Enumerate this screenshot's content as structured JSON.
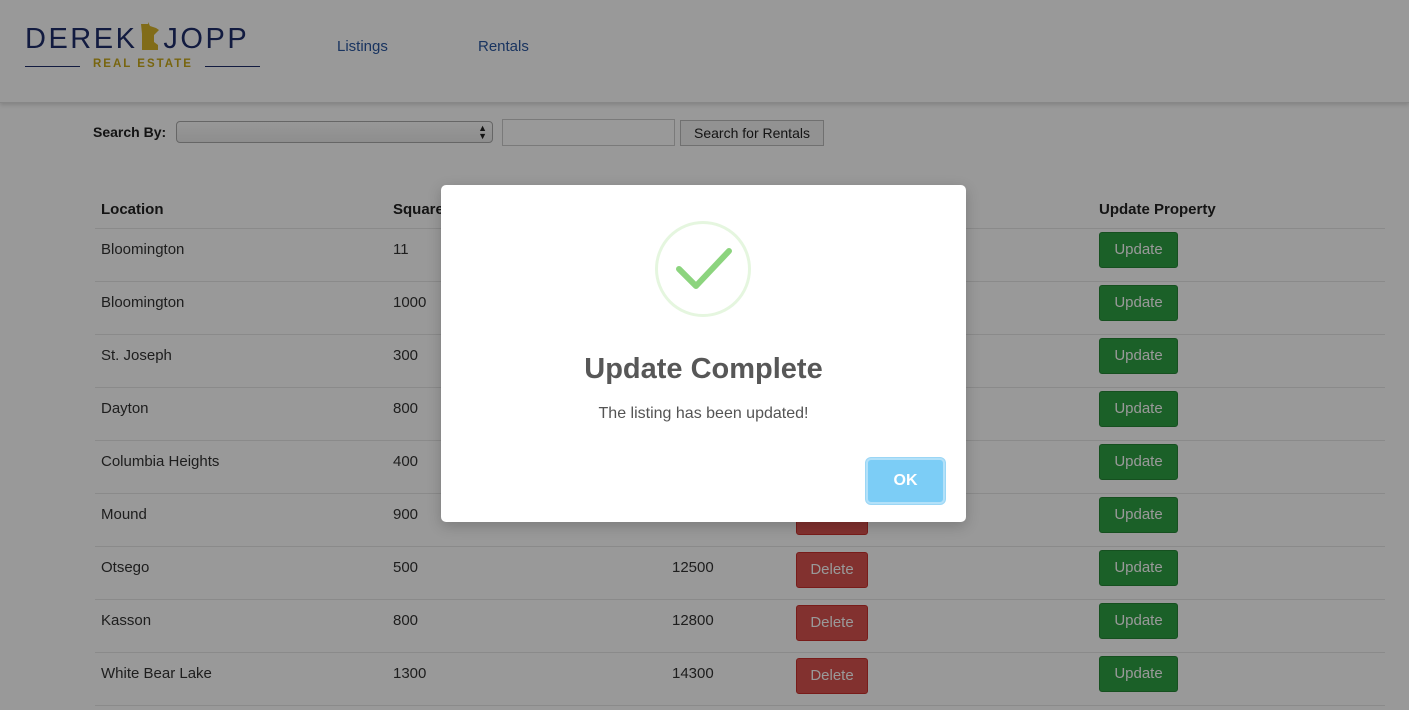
{
  "brand": {
    "name_left": "DEREK",
    "name_right": "JOPP",
    "subtitle": "REAL ESTATE",
    "text_color": "#1f2d6b",
    "accent_color": "#c9a91a"
  },
  "nav": {
    "items": [
      {
        "label": "Listings"
      },
      {
        "label": "Rentals"
      }
    ]
  },
  "search": {
    "label": "Search By:",
    "select_value": "",
    "input_value": "",
    "button_label": "Search for Rentals"
  },
  "table": {
    "headers": {
      "location": "Location",
      "square": "Square",
      "update_property": "Update Property"
    },
    "delete_label": "Delete",
    "update_label": "Update",
    "rows": [
      {
        "location": "Bloomington",
        "square": "11",
        "rent": "",
        "delete_visible": false
      },
      {
        "location": "Bloomington",
        "square": "1000",
        "rent": "",
        "delete_visible": false
      },
      {
        "location": "St. Joseph",
        "square": "300",
        "rent": "",
        "delete_visible": false
      },
      {
        "location": "Dayton",
        "square": "800",
        "rent": "",
        "delete_visible": false
      },
      {
        "location": "Columbia Heights",
        "square": "400",
        "rent": "",
        "delete_visible": false
      },
      {
        "location": "Mound",
        "square": "900",
        "rent": "",
        "delete_visible": true
      },
      {
        "location": "Otsego",
        "square": "500",
        "rent": "12500",
        "delete_visible": true
      },
      {
        "location": "Kasson",
        "square": "800",
        "rent": "12800",
        "delete_visible": true
      },
      {
        "location": "White Bear Lake",
        "square": "1300",
        "rent": "14300",
        "delete_visible": true
      }
    ]
  },
  "colors": {
    "delete": "#d9534f",
    "update": "#2ea043",
    "ok": "#7ccdf6",
    "success": "#8cd47e"
  },
  "modal": {
    "icon": "success-check-icon",
    "title": "Update Complete",
    "text": "The listing has been updated!",
    "ok_label": "OK"
  }
}
